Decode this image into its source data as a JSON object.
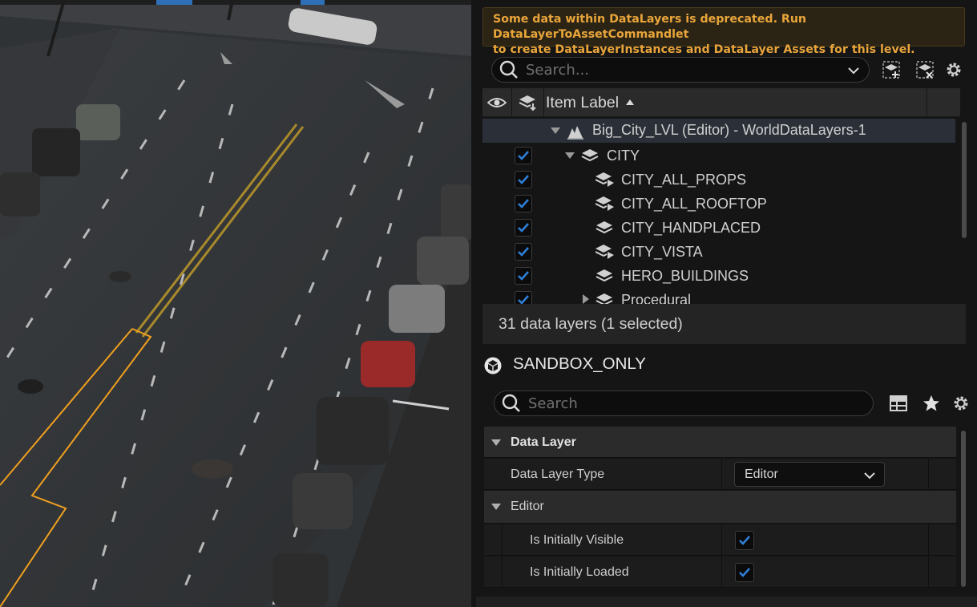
{
  "warning": {
    "line1": "Some data within DataLayers is deprecated. Run DataLayerToAssetCommandlet",
    "line2": "to create DataLayerInstances and DataLayer Assets for this level."
  },
  "outliner": {
    "search_placeholder": "Search...",
    "column_label": "Item Label",
    "world_row": "Big_City_LVL (Editor) - WorldDataLayers-1",
    "layers": [
      {
        "label": "CITY",
        "checked": true
      },
      {
        "label": "CITY_ALL_PROPS",
        "checked": true
      },
      {
        "label": "CITY_ALL_ROOFTOP",
        "checked": true
      },
      {
        "label": "CITY_HANDPLACED",
        "checked": true
      },
      {
        "label": "CITY_VISTA",
        "checked": true
      },
      {
        "label": "HERO_BUILDINGS",
        "checked": true
      },
      {
        "label": "Procedural",
        "checked": true
      }
    ],
    "status": "31 data layers (1 selected)"
  },
  "details": {
    "title": "SANDBOX_ONLY",
    "search_placeholder": "Search",
    "category_data_layer": "Data Layer",
    "data_layer_type_label": "Data Layer Type",
    "data_layer_type_value": "Editor",
    "category_editor": "Editor",
    "initially_visible_label": "Is Initially Visible",
    "initially_visible": true,
    "initially_loaded_label": "Is Initially Loaded",
    "initially_loaded": true
  },
  "colors": {
    "accent": "#2f7fd6",
    "warning_text": "#e9a53a",
    "selection_outline": "#f0a020"
  }
}
